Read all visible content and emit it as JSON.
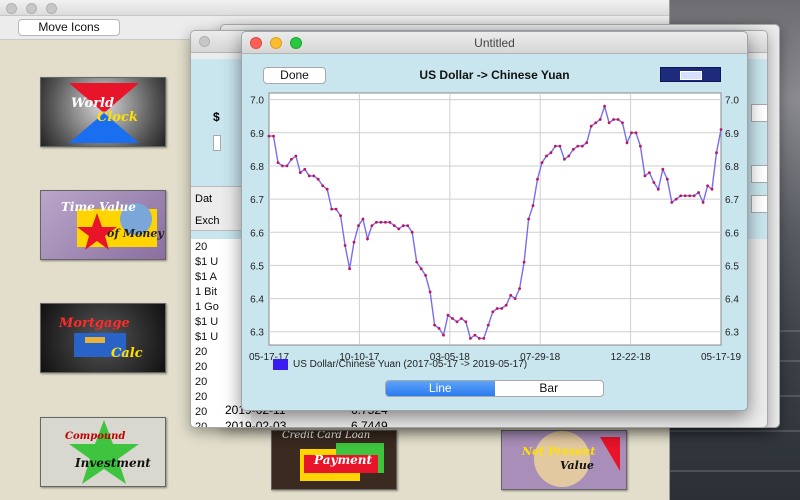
{
  "toolbar": {
    "move_icons_label": "Move Icons"
  },
  "icons": [
    {
      "name": "world-clock",
      "line1": "World",
      "line2": "Clock"
    },
    {
      "name": "time-value-of-money",
      "line1": "Time Value",
      "line2": "of Money"
    },
    {
      "name": "mortgage-calc",
      "line1": "Mortgage",
      "line2": "Calc"
    },
    {
      "name": "compound-investment",
      "line1": "Compound",
      "line2": "Investment"
    },
    {
      "name": "credit-card-loan-payment",
      "line1": "Credit Card Loan",
      "line2": "Payment"
    },
    {
      "name": "net-present-value",
      "line1": "Net Present",
      "line2": "Value"
    }
  ],
  "mid_window": {
    "header_partial": "Exch",
    "tab_partial": "Dat",
    "dollar_partial": "$",
    "list_rows": [
      "20",
      "$1 U",
      "$1 A",
      "1 Bit",
      "1 Go",
      "$1 U",
      "$1 U",
      "20",
      "20",
      "20",
      "20",
      "20",
      "20",
      "20",
      "20"
    ],
    "bottom_rows": [
      {
        "date": "2019-02-11",
        "value": "6.7524"
      },
      {
        "date": "2019-02-03",
        "value": "6.7449"
      }
    ]
  },
  "chart_window": {
    "title": "Untitled",
    "done_label": "Done",
    "chart_title": "US Dollar -> Chinese Yuan",
    "segmented": {
      "line_label": "Line",
      "bar_label": "Bar",
      "selected": "Line"
    },
    "colors": {
      "line": "#7a6cf0",
      "point": "#c0145a",
      "legend": "#3a1cf0"
    }
  },
  "chart_data": {
    "type": "line",
    "title": "US Dollar -> Chinese Yuan",
    "legend": "US Dollar/Chinese Yuan (2017-05-17 -> 2019-05-17)",
    "x_tick_labels": [
      "05-17-17",
      "10-10-17",
      "03-05-18",
      "07-29-18",
      "12-22-18",
      "05-17-19"
    ],
    "y_ticks": [
      "7.0",
      "6.9",
      "6.8",
      "6.7",
      "6.6",
      "6.5",
      "6.4",
      "6.3"
    ],
    "ylim": [
      6.26,
      7.02
    ],
    "grid": true,
    "series": [
      {
        "values": [
          6.89,
          6.89,
          6.81,
          6.8,
          6.8,
          6.82,
          6.83,
          6.78,
          6.79,
          6.77,
          6.77,
          6.76,
          6.74,
          6.73,
          6.67,
          6.67,
          6.65,
          6.56,
          6.49,
          6.57,
          6.62,
          6.64,
          6.58,
          6.62,
          6.63,
          6.63,
          6.63,
          6.63,
          6.62,
          6.61,
          6.62,
          6.62,
          6.6,
          6.51,
          6.49,
          6.47,
          6.42,
          6.32,
          6.31,
          6.29,
          6.35,
          6.34,
          6.33,
          6.34,
          6.33,
          6.28,
          6.29,
          6.28,
          6.28,
          6.32,
          6.36,
          6.37,
          6.37,
          6.38,
          6.41,
          6.4,
          6.43,
          6.51,
          6.64,
          6.68,
          6.76,
          6.81,
          6.83,
          6.84,
          6.86,
          6.86,
          6.82,
          6.83,
          6.85,
          6.86,
          6.86,
          6.87,
          6.92,
          6.93,
          6.94,
          6.98,
          6.93,
          6.94,
          6.94,
          6.93,
          6.87,
          6.9,
          6.9,
          6.86,
          6.77,
          6.78,
          6.75,
          6.73,
          6.79,
          6.76,
          6.69,
          6.7,
          6.71,
          6.71,
          6.71,
          6.71,
          6.72,
          6.69,
          6.74,
          6.73,
          6.84,
          6.91
        ]
      }
    ]
  }
}
